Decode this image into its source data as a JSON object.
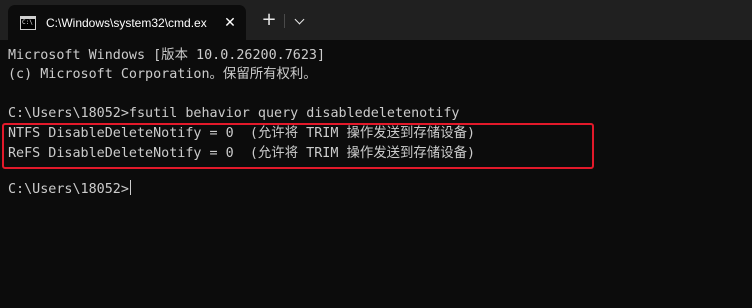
{
  "window": {
    "tab_title": "C:\\Windows\\system32\\cmd.ex",
    "tab_close_glyph": "✕",
    "new_tab_glyph": "+"
  },
  "console": {
    "lines": [
      "Microsoft Windows [版本 10.0.26200.7623]",
      "(c) Microsoft Corporation。保留所有权利。",
      "C:\\Users\\18052>fsutil behavior query disabledeletenotify",
      "NTFS DisableDeleteNotify = 0  (允许将 TRIM 操作发送到存储设备)",
      "ReFS DisableDeleteNotify = 0  (允许将 TRIM 操作发送到存储设备)",
      "C:\\Users\\18052>"
    ]
  },
  "colors": {
    "background": "#0c0c0c",
    "text": "#cccccc",
    "titlebar": "#202020",
    "highlight": "#e3192a"
  },
  "icons": [
    "cmd-icon",
    "close-icon",
    "plus-icon",
    "chevron-down-icon"
  ]
}
